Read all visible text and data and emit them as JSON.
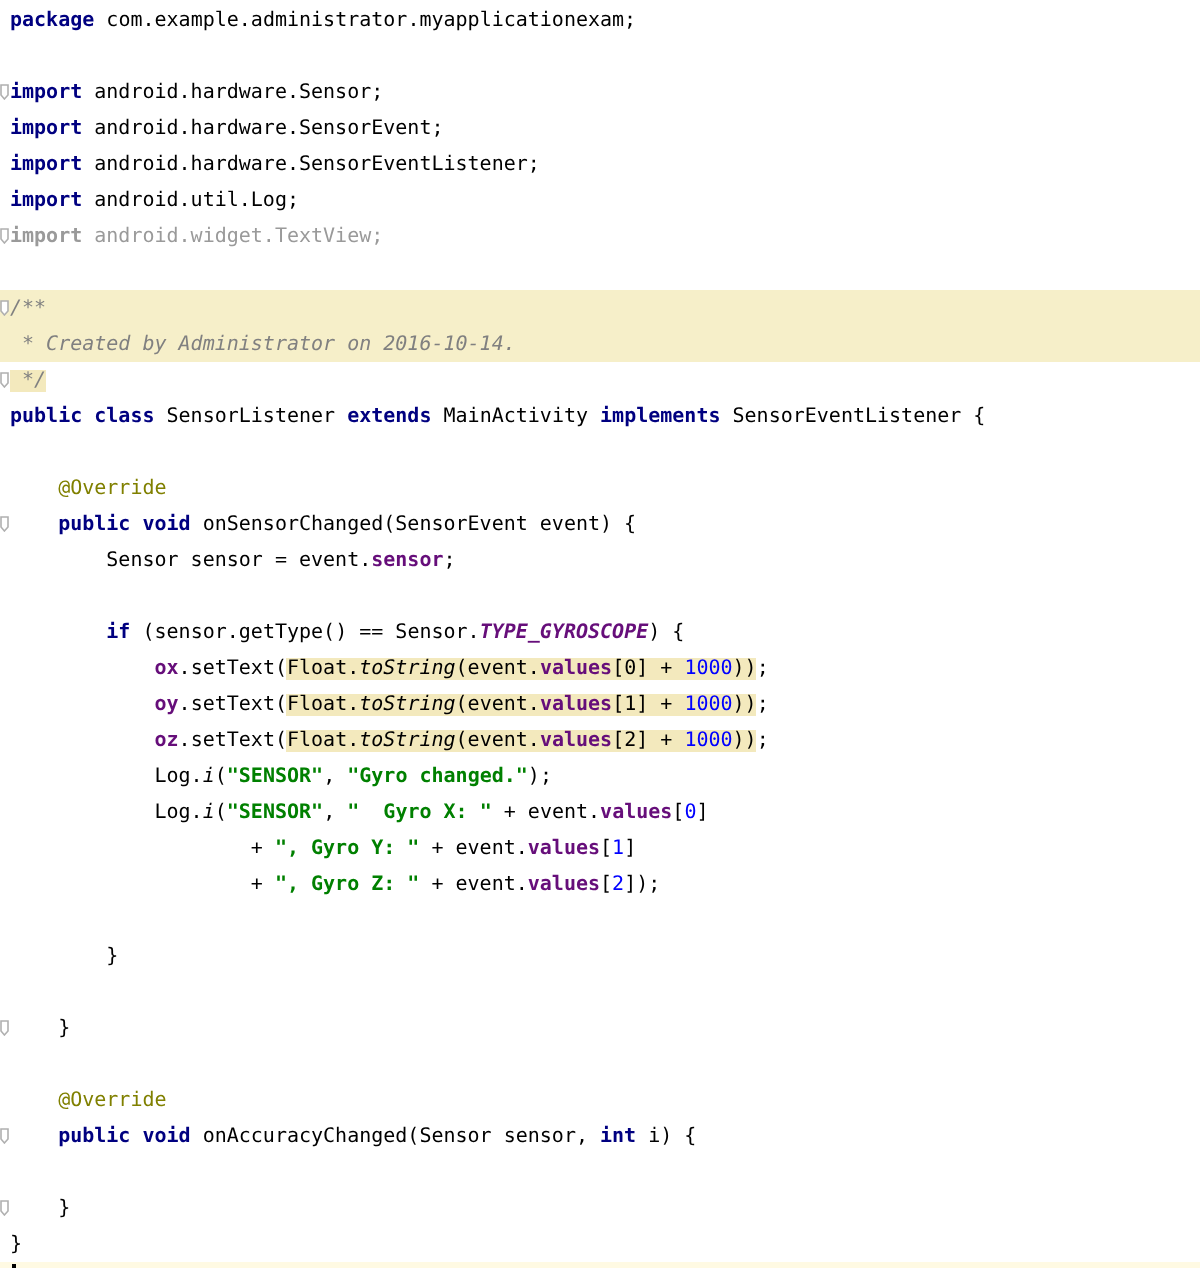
{
  "editor": {
    "lines": [
      {
        "kind": "plain",
        "fold": false,
        "tokens": [
          {
            "text": "package",
            "kind": "kw",
            "highlighted": false
          },
          {
            "text": " com.example.administrator.myapplicationexam;",
            "kind": "plain",
            "highlighted": false
          }
        ]
      },
      {
        "kind": "plain",
        "fold": false
      },
      {
        "kind": "plain",
        "fold": true,
        "tokens": [
          {
            "text": "import",
            "kind": "kw",
            "highlighted": false
          },
          {
            "text": " android.hardware.Sensor;",
            "kind": "plain",
            "highlighted": false
          }
        ]
      },
      {
        "kind": "plain",
        "fold": false,
        "tokens": [
          {
            "text": "import",
            "kind": "kw",
            "highlighted": false
          },
          {
            "text": " android.hardware.SensorEvent;",
            "kind": "plain",
            "highlighted": false
          }
        ]
      },
      {
        "kind": "plain",
        "fold": false,
        "tokens": [
          {
            "text": "import",
            "kind": "kw",
            "highlighted": false
          },
          {
            "text": " android.hardware.SensorEventListener;",
            "kind": "plain",
            "highlighted": false
          }
        ]
      },
      {
        "kind": "plain",
        "fold": false,
        "tokens": [
          {
            "text": "import",
            "kind": "kw",
            "highlighted": false
          },
          {
            "text": " android.util.Log;",
            "kind": "plain",
            "highlighted": false
          }
        ]
      },
      {
        "kind": "plain",
        "fold": true,
        "tokens": [
          {
            "text": "import",
            "kind": "unusedkw",
            "highlighted": false
          },
          {
            "text": " android.widget.TextView;",
            "kind": "unused",
            "highlighted": false
          }
        ]
      },
      {
        "kind": "plain",
        "fold": false
      },
      {
        "kind": "doc",
        "fold": true,
        "tokens": [
          {
            "text": "/**",
            "kind": "comment",
            "highlighted": false
          }
        ]
      },
      {
        "kind": "doc",
        "fold": false,
        "tokens": [
          {
            "text": " * Created by Administrator on 2016-10-14.",
            "kind": "comment",
            "highlighted": false
          }
        ]
      },
      {
        "kind": "plain",
        "fold": true,
        "tokens": [
          {
            "text": " */",
            "kind": "comment",
            "highlighted": true
          }
        ]
      },
      {
        "kind": "plain",
        "fold": false,
        "tokens": [
          {
            "text": "public class",
            "kind": "kw",
            "highlighted": false
          },
          {
            "text": " SensorListener ",
            "kind": "plain",
            "highlighted": false
          },
          {
            "text": "extends",
            "kind": "kw",
            "highlighted": false
          },
          {
            "text": " MainActivity ",
            "kind": "plain",
            "highlighted": false
          },
          {
            "text": "implements",
            "kind": "kw",
            "highlighted": false
          },
          {
            "text": " SensorEventListener {",
            "kind": "plain",
            "highlighted": false
          }
        ]
      },
      {
        "kind": "plain",
        "fold": false
      },
      {
        "kind": "plain",
        "fold": false,
        "tokens": [
          {
            "text": "    @Override",
            "kind": "annotation",
            "highlighted": false
          }
        ]
      },
      {
        "kind": "plain",
        "fold": true,
        "tokens": [
          {
            "text": "    public void",
            "kind": "kw",
            "highlighted": false
          },
          {
            "text": " onSensorChanged(SensorEvent event) {",
            "kind": "plain",
            "highlighted": false
          }
        ]
      },
      {
        "kind": "plain",
        "fold": false,
        "tokens": [
          {
            "text": "        Sensor sensor = event.",
            "kind": "plain",
            "highlighted": false
          },
          {
            "text": "sensor",
            "kind": "field",
            "highlighted": false
          },
          {
            "text": ";",
            "kind": "plain",
            "highlighted": false
          }
        ]
      },
      {
        "kind": "plain",
        "fold": false
      },
      {
        "kind": "plain",
        "fold": false,
        "tokens": [
          {
            "text": "        if",
            "kind": "kw",
            "highlighted": false
          },
          {
            "text": " (sensor.getType() == Sensor.",
            "kind": "plain",
            "highlighted": false
          },
          {
            "text": "TYPE_GYROSCOPE",
            "kind": "static",
            "highlighted": false
          },
          {
            "text": ") {",
            "kind": "plain",
            "highlighted": false
          }
        ]
      },
      {
        "kind": "plain",
        "fold": false,
        "tokens": [
          {
            "text": "            ox",
            "kind": "field",
            "highlighted": false
          },
          {
            "text": ".setText(",
            "kind": "plain",
            "highlighted": false
          },
          {
            "text": "Float.",
            "kind": "plain",
            "highlighted": true
          },
          {
            "text": "toString",
            "kind": "italic",
            "highlighted": true
          },
          {
            "text": "(event.",
            "kind": "plain",
            "highlighted": true
          },
          {
            "text": "values",
            "kind": "field",
            "highlighted": true
          },
          {
            "text": "[0] + ",
            "kind": "plain",
            "highlighted": true
          },
          {
            "text": "1000",
            "kind": "number",
            "highlighted": true
          },
          {
            "text": "))",
            "kind": "plain",
            "highlighted": true
          },
          {
            "text": ";",
            "kind": "plain",
            "highlighted": false
          }
        ]
      },
      {
        "kind": "plain",
        "fold": false,
        "tokens": [
          {
            "text": "            oy",
            "kind": "field",
            "highlighted": false
          },
          {
            "text": ".setText(",
            "kind": "plain",
            "highlighted": false
          },
          {
            "text": "Float.",
            "kind": "plain",
            "highlighted": true
          },
          {
            "text": "toString",
            "kind": "italic",
            "highlighted": true
          },
          {
            "text": "(event.",
            "kind": "plain",
            "highlighted": true
          },
          {
            "text": "values",
            "kind": "field",
            "highlighted": true
          },
          {
            "text": "[1] + ",
            "kind": "plain",
            "highlighted": true
          },
          {
            "text": "1000",
            "kind": "number",
            "highlighted": true
          },
          {
            "text": "))",
            "kind": "plain",
            "highlighted": true
          },
          {
            "text": ";",
            "kind": "plain",
            "highlighted": false
          }
        ]
      },
      {
        "kind": "plain",
        "fold": false,
        "tokens": [
          {
            "text": "            oz",
            "kind": "field",
            "highlighted": false
          },
          {
            "text": ".setText(",
            "kind": "plain",
            "highlighted": false
          },
          {
            "text": "Float.",
            "kind": "plain",
            "highlighted": true
          },
          {
            "text": "toString",
            "kind": "italic",
            "highlighted": true
          },
          {
            "text": "(event.",
            "kind": "plain",
            "highlighted": true
          },
          {
            "text": "values",
            "kind": "field",
            "highlighted": true
          },
          {
            "text": "[2] + ",
            "kind": "plain",
            "highlighted": true
          },
          {
            "text": "1000",
            "kind": "number",
            "highlighted": true
          },
          {
            "text": "))",
            "kind": "plain",
            "highlighted": true
          },
          {
            "text": ";",
            "kind": "plain",
            "highlighted": false
          }
        ]
      },
      {
        "kind": "plain",
        "fold": false,
        "tokens": [
          {
            "text": "            Log.",
            "kind": "plain",
            "highlighted": false
          },
          {
            "text": "i",
            "kind": "italic",
            "highlighted": false
          },
          {
            "text": "(",
            "kind": "plain",
            "highlighted": false
          },
          {
            "text": "\"SENSOR\"",
            "kind": "string",
            "highlighted": false
          },
          {
            "text": ", ",
            "kind": "plain",
            "highlighted": false
          },
          {
            "text": "\"Gyro changed.\"",
            "kind": "string",
            "highlighted": false
          },
          {
            "text": ");",
            "kind": "plain",
            "highlighted": false
          }
        ]
      },
      {
        "kind": "plain",
        "fold": false,
        "tokens": [
          {
            "text": "            Log.",
            "kind": "plain",
            "highlighted": false
          },
          {
            "text": "i",
            "kind": "italic",
            "highlighted": false
          },
          {
            "text": "(",
            "kind": "plain",
            "highlighted": false
          },
          {
            "text": "\"SENSOR\"",
            "kind": "string",
            "highlighted": false
          },
          {
            "text": ", ",
            "kind": "plain",
            "highlighted": false
          },
          {
            "text": "\"  Gyro X: \"",
            "kind": "string",
            "highlighted": false
          },
          {
            "text": " + event.",
            "kind": "plain",
            "highlighted": false
          },
          {
            "text": "values",
            "kind": "field",
            "highlighted": false
          },
          {
            "text": "[",
            "kind": "plain",
            "highlighted": false
          },
          {
            "text": "0",
            "kind": "number",
            "highlighted": false
          },
          {
            "text": "]",
            "kind": "plain",
            "highlighted": false
          }
        ]
      },
      {
        "kind": "plain",
        "fold": false,
        "tokens": [
          {
            "text": "                    + ",
            "kind": "plain",
            "highlighted": false
          },
          {
            "text": "\", Gyro Y: \"",
            "kind": "string",
            "highlighted": false
          },
          {
            "text": " + event.",
            "kind": "plain",
            "highlighted": false
          },
          {
            "text": "values",
            "kind": "field",
            "highlighted": false
          },
          {
            "text": "[",
            "kind": "plain",
            "highlighted": false
          },
          {
            "text": "1",
            "kind": "number",
            "highlighted": false
          },
          {
            "text": "]",
            "kind": "plain",
            "highlighted": false
          }
        ]
      },
      {
        "kind": "plain",
        "fold": false,
        "tokens": [
          {
            "text": "                    + ",
            "kind": "plain",
            "highlighted": false
          },
          {
            "text": "\", Gyro Z: \"",
            "kind": "string",
            "highlighted": false
          },
          {
            "text": " + event.",
            "kind": "plain",
            "highlighted": false
          },
          {
            "text": "values",
            "kind": "field",
            "highlighted": false
          },
          {
            "text": "[",
            "kind": "plain",
            "highlighted": false
          },
          {
            "text": "2",
            "kind": "number",
            "highlighted": false
          },
          {
            "text": "]);",
            "kind": "plain",
            "highlighted": false
          }
        ]
      },
      {
        "kind": "plain",
        "fold": false
      },
      {
        "kind": "plain",
        "fold": false,
        "tokens": [
          {
            "text": "        }",
            "kind": "plain",
            "highlighted": false
          }
        ]
      },
      {
        "kind": "plain",
        "fold": false
      },
      {
        "kind": "plain",
        "fold": true,
        "tokens": [
          {
            "text": "    }",
            "kind": "plain",
            "highlighted": false
          }
        ]
      },
      {
        "kind": "plain",
        "fold": false
      },
      {
        "kind": "plain",
        "fold": false,
        "tokens": [
          {
            "text": "    @Override",
            "kind": "annotation",
            "highlighted": false
          }
        ]
      },
      {
        "kind": "plain",
        "fold": true,
        "tokens": [
          {
            "text": "    public void",
            "kind": "kw",
            "highlighted": false
          },
          {
            "text": " onAccuracyChanged(Sensor sensor, ",
            "kind": "plain",
            "highlighted": false
          },
          {
            "text": "int",
            "kind": "kw",
            "highlighted": false
          },
          {
            "text": " i) {",
            "kind": "plain",
            "highlighted": false
          }
        ]
      },
      {
        "kind": "plain",
        "fold": false
      },
      {
        "kind": "plain",
        "fold": true,
        "tokens": [
          {
            "text": "    }",
            "kind": "plain",
            "highlighted": false
          }
        ]
      },
      {
        "kind": "plain",
        "fold": false,
        "tokens": [
          {
            "text": "}",
            "kind": "plain",
            "highlighted": false
          }
        ]
      },
      {
        "kind": "caret",
        "fold": false
      }
    ]
  }
}
